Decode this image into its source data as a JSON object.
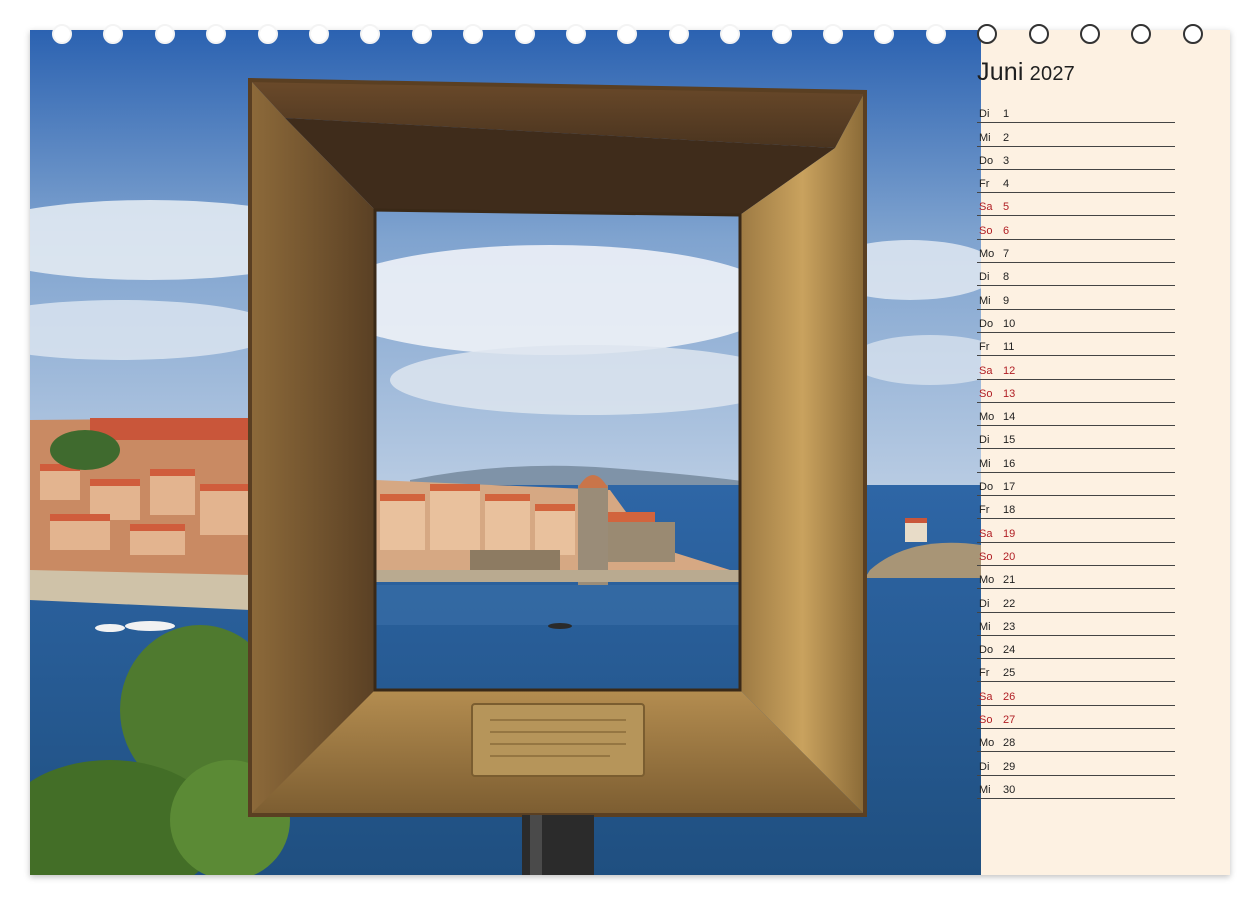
{
  "calendar": {
    "month": "Juni",
    "year": "2027",
    "colors": {
      "weekday_text": "#1f1f1f",
      "weekend_text": "#b01e24",
      "panel_background": "#fdf1e2",
      "rule_line": "#444444"
    },
    "days": [
      {
        "dow": "Di",
        "day": "1",
        "weekend": false
      },
      {
        "dow": "Mi",
        "day": "2",
        "weekend": false
      },
      {
        "dow": "Do",
        "day": "3",
        "weekend": false
      },
      {
        "dow": "Fr",
        "day": "4",
        "weekend": false
      },
      {
        "dow": "Sa",
        "day": "5",
        "weekend": true
      },
      {
        "dow": "So",
        "day": "6",
        "weekend": true
      },
      {
        "dow": "Mo",
        "day": "7",
        "weekend": false
      },
      {
        "dow": "Di",
        "day": "8",
        "weekend": false
      },
      {
        "dow": "Mi",
        "day": "9",
        "weekend": false
      },
      {
        "dow": "Do",
        "day": "10",
        "weekend": false
      },
      {
        "dow": "Fr",
        "day": "11",
        "weekend": false
      },
      {
        "dow": "Sa",
        "day": "12",
        "weekend": true
      },
      {
        "dow": "So",
        "day": "13",
        "weekend": true
      },
      {
        "dow": "Mo",
        "day": "14",
        "weekend": false
      },
      {
        "dow": "Di",
        "day": "15",
        "weekend": false
      },
      {
        "dow": "Mi",
        "day": "16",
        "weekend": false
      },
      {
        "dow": "Do",
        "day": "17",
        "weekend": false
      },
      {
        "dow": "Fr",
        "day": "18",
        "weekend": false
      },
      {
        "dow": "Sa",
        "day": "19",
        "weekend": true
      },
      {
        "dow": "So",
        "day": "20",
        "weekend": true
      },
      {
        "dow": "Mo",
        "day": "21",
        "weekend": false
      },
      {
        "dow": "Di",
        "day": "22",
        "weekend": false
      },
      {
        "dow": "Mi",
        "day": "23",
        "weekend": false
      },
      {
        "dow": "Do",
        "day": "24",
        "weekend": false
      },
      {
        "dow": "Fr",
        "day": "25",
        "weekend": false
      },
      {
        "dow": "Sa",
        "day": "26",
        "weekend": true
      },
      {
        "dow": "So",
        "day": "27",
        "weekend": true
      },
      {
        "dow": "Mo",
        "day": "28",
        "weekend": false
      },
      {
        "dow": "Di",
        "day": "29",
        "weekend": false
      },
      {
        "dow": "Mi",
        "day": "30",
        "weekend": false
      }
    ]
  },
  "photo": {
    "plaque_icon": "engraved-plaque-icon",
    "colors": {
      "sky_top": "#2d66b4",
      "sea": "#2f6aa3",
      "frame_bronze": "#8a6b3a",
      "rooftops": "#d9794e"
    }
  }
}
